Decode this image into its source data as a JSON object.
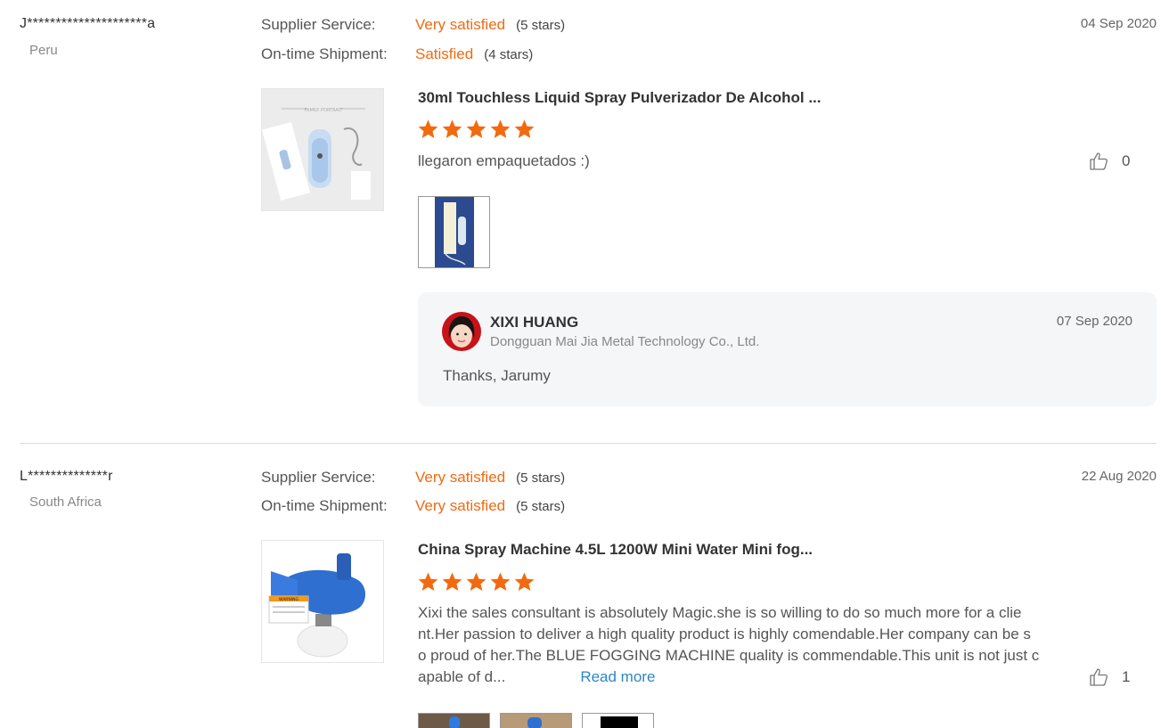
{
  "reviews": [
    {
      "buyer": "J*********************a",
      "country": "Peru",
      "date": "04 Sep 2020",
      "supplier_service_label": "Supplier Service:",
      "supplier_service_value": "Very satisfied",
      "supplier_service_stars": "(5 stars)",
      "shipment_label": "On-time Shipment:",
      "shipment_value": "Satisfied",
      "shipment_stars": "(4 stars)",
      "product_title": "30ml Touchless Liquid Spray Pulverizador De Alcohol ...",
      "product_image_text": "FAMILY PORTRAIT",
      "rating": 5,
      "text": "llegaron empaquetados :)",
      "likes": "0",
      "reply": {
        "name": "XIXI HUANG",
        "company": "Dongguan Mai Jia Metal Technology Co., Ltd.",
        "date": "07 Sep 2020",
        "text": "Thanks, Jarumy"
      }
    },
    {
      "buyer": "L**************r",
      "country": "South Africa",
      "date": "22 Aug 2020",
      "supplier_service_label": "Supplier Service:",
      "supplier_service_value": "Very satisfied",
      "supplier_service_stars": "(5 stars)",
      "shipment_label": "On-time Shipment:",
      "shipment_value": "Very satisfied",
      "shipment_stars": "(5 stars)",
      "product_title": "China Spray Machine 4.5L 1200W Mini Water Mini fog...",
      "product_image_text": "WARNING",
      "rating": 5,
      "text_lines": [
        "Xixi the sales consultant is absolutely Magic.she is so willing to do so much more for a clie",
        "nt.Her passion to deliver a high quality product is highly comendable.Her company can be s",
        "o proud of her.The BLUE FOGGING MACHINE quality is commendable.This unit is not just c",
        "apable of d..."
      ],
      "read_more": "Read more",
      "likes": "1"
    }
  ],
  "colors": {
    "accent": "#f26a10",
    "link": "#2f86c5",
    "reply_bg": "#f5f6f7"
  },
  "icons": [
    "star-icon",
    "thumbs-up-icon"
  ]
}
